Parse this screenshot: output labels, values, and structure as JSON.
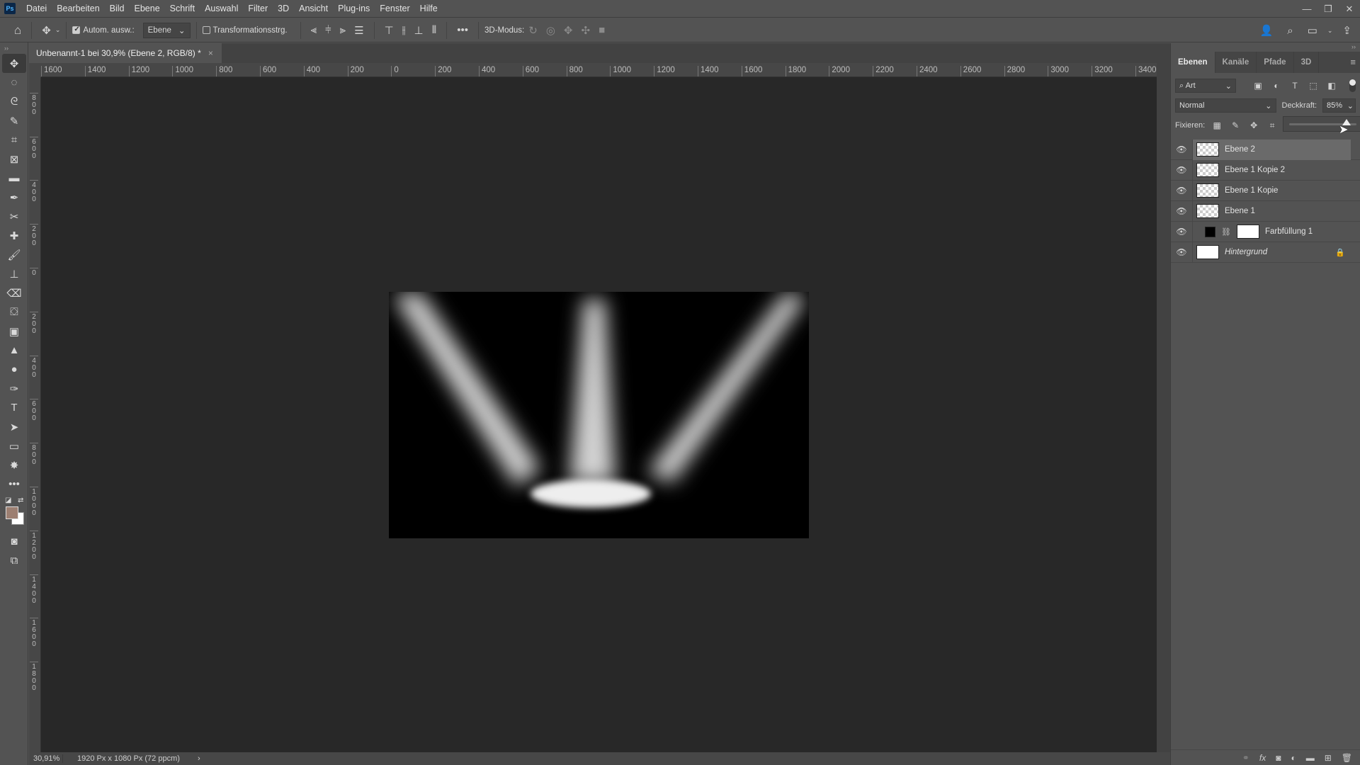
{
  "app": {
    "logo": "Ps"
  },
  "menu": [
    "Datei",
    "Bearbeiten",
    "Bild",
    "Ebene",
    "Schrift",
    "Auswahl",
    "Filter",
    "3D",
    "Ansicht",
    "Plug-ins",
    "Fenster",
    "Hilfe"
  ],
  "window_controls": {
    "minimize": "—",
    "restore": "❐",
    "close": "✕"
  },
  "options": {
    "auto_select_label": "Autom. ausw.:",
    "auto_select_checked": true,
    "auto_select_target": "Ebene",
    "transform_label": "Transformationsstrg.",
    "transform_checked": false,
    "more": "•••",
    "mode_3d": "3D-Modus:"
  },
  "document_tab": {
    "title": "Unbenannt-1 bei 30,9% (Ebene 2, RGB/8) *",
    "close": "×"
  },
  "ruler_h": [
    "1600",
    "1400",
    "1200",
    "1000",
    "800",
    "600",
    "400",
    "200",
    "0",
    "200",
    "400",
    "600",
    "800",
    "1000",
    "1200",
    "1400",
    "1600",
    "1800",
    "2000",
    "2200",
    "2400",
    "2600",
    "2800",
    "3000",
    "3200",
    "3400"
  ],
  "ruler_v": [
    "0",
    "800",
    "600",
    "400",
    "200",
    "0",
    "200",
    "400",
    "600",
    "800",
    "1000",
    "1200",
    "1400",
    "1600",
    "1800"
  ],
  "status": {
    "zoom": "30,91%",
    "doc_info": "1920 Px x 1080 Px (72 ppcm)",
    "arrow": "›"
  },
  "colors": {
    "foreground": "#9c7f72",
    "background": "#ffffff",
    "canvas_bg": "#282828"
  },
  "panel": {
    "tabs": [
      "Ebenen",
      "Kanäle",
      "Pfade",
      "3D"
    ],
    "active_tab": 0,
    "filter_kind": "Art",
    "blend_mode": "Normal",
    "opacity_label": "Deckkraft:",
    "opacity_value": "85%",
    "opacity_fraction": 0.85,
    "lock_label": "Fixieren:",
    "layers": [
      {
        "name": "Ebene 2",
        "type": "pixel",
        "visible": true,
        "selected": true
      },
      {
        "name": "Ebene 1 Kopie 2",
        "type": "pixel",
        "visible": true,
        "selected": false
      },
      {
        "name": "Ebene 1 Kopie",
        "type": "pixel",
        "visible": true,
        "selected": false
      },
      {
        "name": "Ebene 1",
        "type": "pixel",
        "visible": true,
        "selected": false
      },
      {
        "name": "Farbfüllung 1",
        "type": "fill",
        "visible": true,
        "selected": false
      },
      {
        "name": "Hintergrund",
        "type": "background",
        "visible": true,
        "selected": false,
        "locked": true
      }
    ]
  }
}
